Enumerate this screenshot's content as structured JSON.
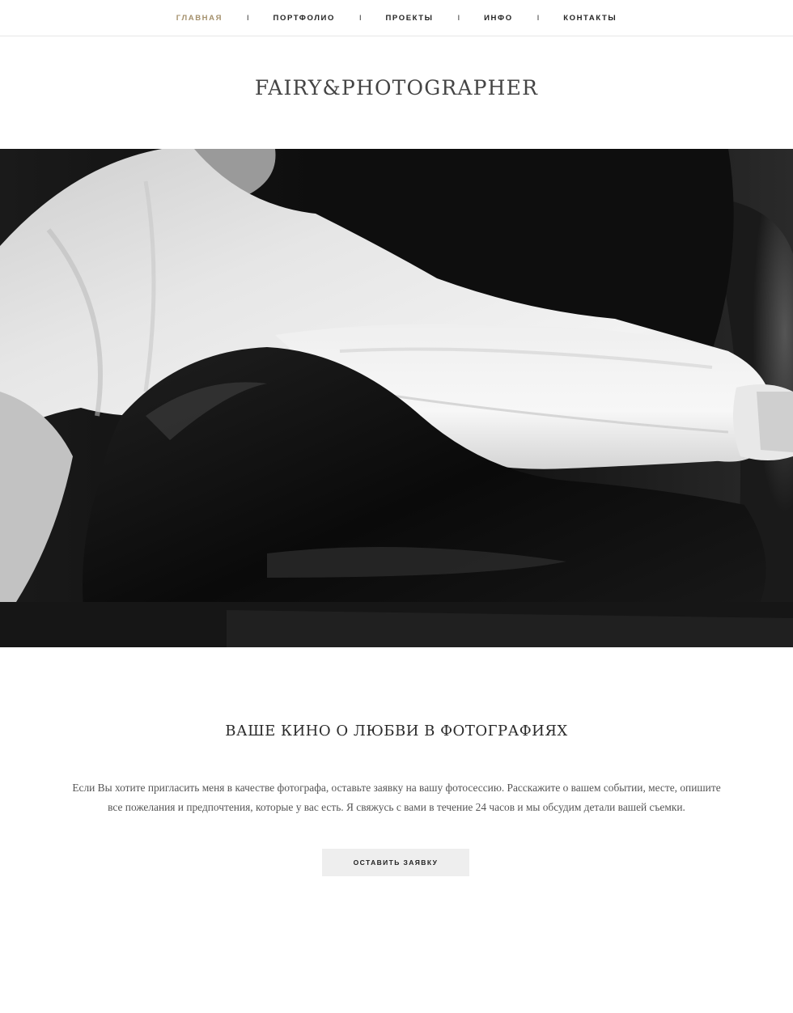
{
  "nav": {
    "items": [
      {
        "label": "ГЛАВНАЯ",
        "active": true
      },
      {
        "label": "ПОРТФОЛИО",
        "active": false
      },
      {
        "label": "ПРОЕКТЫ",
        "active": false
      },
      {
        "label": "ИНФО",
        "active": false
      },
      {
        "label": "КОНТАКТЫ",
        "active": false
      }
    ],
    "separator": "I"
  },
  "brand": {
    "title": "FAIRY&PHOTOGRAPHER"
  },
  "hero": {
    "style": "black-and-white photograph"
  },
  "content": {
    "headline": "ВАШЕ КИНО О ЛЮБВИ В ФОТОГРАФИЯХ",
    "intro_line1": "Если Вы хотите пригласить меня в качестве фотографа, оставьте заявку на вашу фотосессию. Расскажите о вашем событии, месте, опишите",
    "intro_line2": "все пожелания и предпочтения, которые у вас есть. Я свяжусь с вами в течение 24 часов и мы обсудим детали вашей съемки.",
    "cta_label": "ОСТАВИТЬ ЗАЯВКУ"
  },
  "colors": {
    "accent": "#a4906c",
    "text": "#222222",
    "button_bg": "#eeeeee"
  }
}
